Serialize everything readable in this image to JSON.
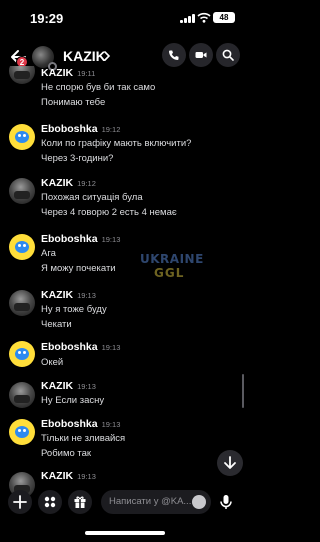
{
  "status": {
    "time": "19:29",
    "battery": "48"
  },
  "header": {
    "back_badge": "2",
    "title": "KAZIK",
    "chevron": ">",
    "icons": [
      "call-icon",
      "video-icon",
      "search-icon"
    ]
  },
  "messages": [
    {
      "author": "KAZIK",
      "time": "19:11",
      "avatar": "kazik",
      "lines": [
        "Не спорю був би так само",
        "Понимаю тебе"
      ]
    },
    {
      "author": "Eboboshka",
      "time": "19:12",
      "avatar": "ebo",
      "lines": [
        "Коли по графіку мають включити?",
        "Через 3-години?"
      ]
    },
    {
      "author": "KAZIK",
      "time": "19:12",
      "avatar": "kazik",
      "lines": [
        "Похожая ситуація була",
        "Через 4 говорю 2 есть 4 немає"
      ]
    },
    {
      "author": "Eboboshka",
      "time": "19:13",
      "avatar": "ebo",
      "lines": [
        "Ага",
        "Я можу почекати"
      ]
    },
    {
      "author": "KAZIK",
      "time": "19:13",
      "avatar": "kazik",
      "lines": [
        "Ну я тоже буду",
        "Чекати"
      ]
    },
    {
      "author": "Eboboshka",
      "time": "19:13",
      "avatar": "ebo",
      "lines": [
        "Окей"
      ]
    },
    {
      "author": "KAZIK",
      "time": "19:13",
      "avatar": "kazik",
      "lines": [
        "Ну Если засну"
      ]
    },
    {
      "author": "Eboboshka",
      "time": "19:13",
      "avatar": "ebo",
      "lines": [
        "Тільки не зливайся",
        "Робимо так"
      ]
    },
    {
      "author": "KAZIK",
      "time": "19:13",
      "avatar": "kazik",
      "lines": []
    }
  ],
  "watermark": {
    "line1": "UKRAINE",
    "line2": "GGL"
  },
  "composer": {
    "placeholder": "Написати у @KA...",
    "icons": [
      "plus-icon",
      "apps-icon",
      "gift-icon",
      "emoji-icon",
      "mic-icon"
    ]
  },
  "colors": {
    "background": "#000000",
    "badge": "#e0394a",
    "ebo_avatar": "#ffde3a"
  }
}
